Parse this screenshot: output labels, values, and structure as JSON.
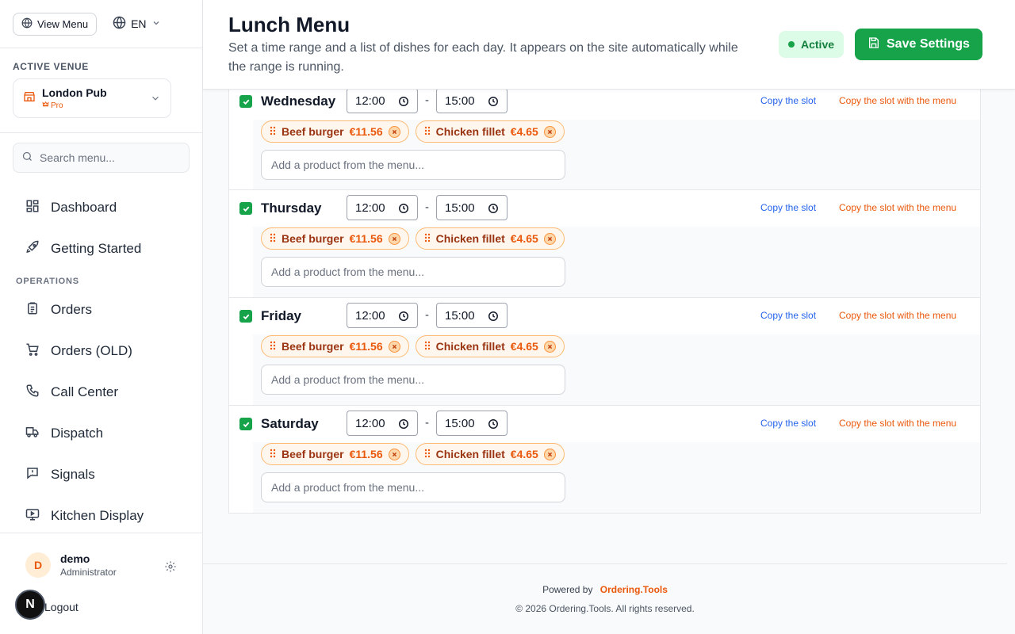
{
  "sidebar": {
    "view_menu_label": "View Menu",
    "language": "EN",
    "venue_section_label": "ACTIVE VENUE",
    "venue_name": "London Pub",
    "venue_plan": "Pro",
    "search_placeholder": "Search menu...",
    "nav_top": [
      {
        "label": "Dashboard",
        "icon": "dashboard-icon"
      },
      {
        "label": "Getting Started",
        "icon": "rocket-icon"
      }
    ],
    "operations_label": "OPERATIONS",
    "nav_ops": [
      {
        "label": "Orders",
        "icon": "clipboard-icon"
      },
      {
        "label": "Orders (OLD)",
        "icon": "cart-icon"
      },
      {
        "label": "Call Center",
        "icon": "phone-icon"
      },
      {
        "label": "Dispatch",
        "icon": "truck-icon"
      },
      {
        "label": "Signals",
        "icon": "alert-icon"
      },
      {
        "label": "Kitchen Display",
        "icon": "monitor-icon"
      }
    ],
    "user": {
      "initial": "D",
      "name": "demo",
      "role": "Administrator"
    },
    "logout_label": "Logout",
    "badge_letter": "N"
  },
  "header": {
    "title": "Lunch Menu",
    "description": "Set a time range and a list of dishes for each day. It appears on the site automatically while the range is running.",
    "status": "Active",
    "save_label": "Save Settings"
  },
  "labels": {
    "copy_slot": "Copy the slot",
    "copy_slot_menu": "Copy the slot with the menu",
    "add_placeholder": "Add a product from the menu...",
    "dash": "-"
  },
  "days": [
    {
      "name": "Wednesday",
      "start": "12:00",
      "end": "15:00",
      "products": [
        {
          "name": "Beef burger",
          "price": "€11.56"
        },
        {
          "name": "Chicken fillet",
          "price": "€4.65"
        }
      ]
    },
    {
      "name": "Thursday",
      "start": "12:00",
      "end": "15:00",
      "products": [
        {
          "name": "Beef burger",
          "price": "€11.56"
        },
        {
          "name": "Chicken fillet",
          "price": "€4.65"
        }
      ]
    },
    {
      "name": "Friday",
      "start": "12:00",
      "end": "15:00",
      "products": [
        {
          "name": "Beef burger",
          "price": "€11.56"
        },
        {
          "name": "Chicken fillet",
          "price": "€4.65"
        }
      ]
    },
    {
      "name": "Saturday",
      "start": "12:00",
      "end": "15:00",
      "products": [
        {
          "name": "Beef burger",
          "price": "€11.56"
        },
        {
          "name": "Chicken fillet",
          "price": "€4.65"
        }
      ]
    }
  ],
  "footer": {
    "powered_by": "Powered by",
    "brand": "Ordering.Tools",
    "copyright": "© 2026 Ordering.Tools. All rights reserved."
  },
  "colors": {
    "accent": "#16a34a",
    "brand": "#ea580c",
    "link": "#2563eb"
  }
}
